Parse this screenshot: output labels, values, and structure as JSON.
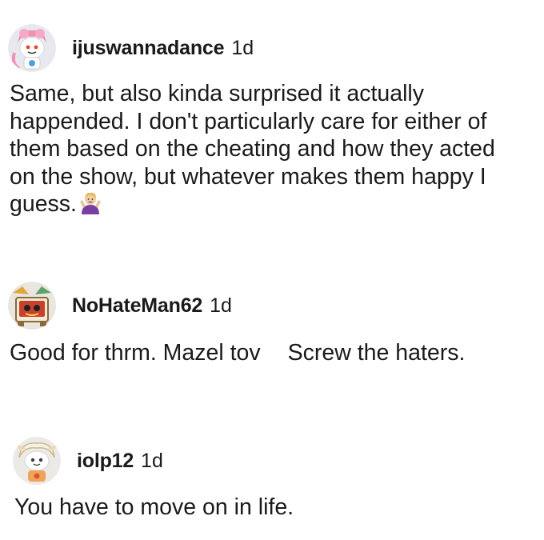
{
  "comments": [
    {
      "avatar_icon": "pink-hair-snoo-avatar-icon",
      "username": "ijuswannadance",
      "time": "1d",
      "lines": [
        "Same, but also kinda surprised it actually",
        "happended. I don't particularly care for either of",
        "them based on the cheating and how they acted",
        "on the show, but whatever makes them happy I",
        "guess."
      ],
      "emoji": "person-shrugging-emoji"
    },
    {
      "avatar_icon": "treasure-chest-snoo-avatar-icon",
      "username": "NoHateMan62",
      "time": "1d",
      "text_part1": "Good for thrm. Mazel tov",
      "text_part2": "Screw the haters."
    },
    {
      "avatar_icon": "white-hair-snoo-avatar-icon",
      "username": "iolp12",
      "time": "1d",
      "text": "You have to move on in life."
    }
  ]
}
